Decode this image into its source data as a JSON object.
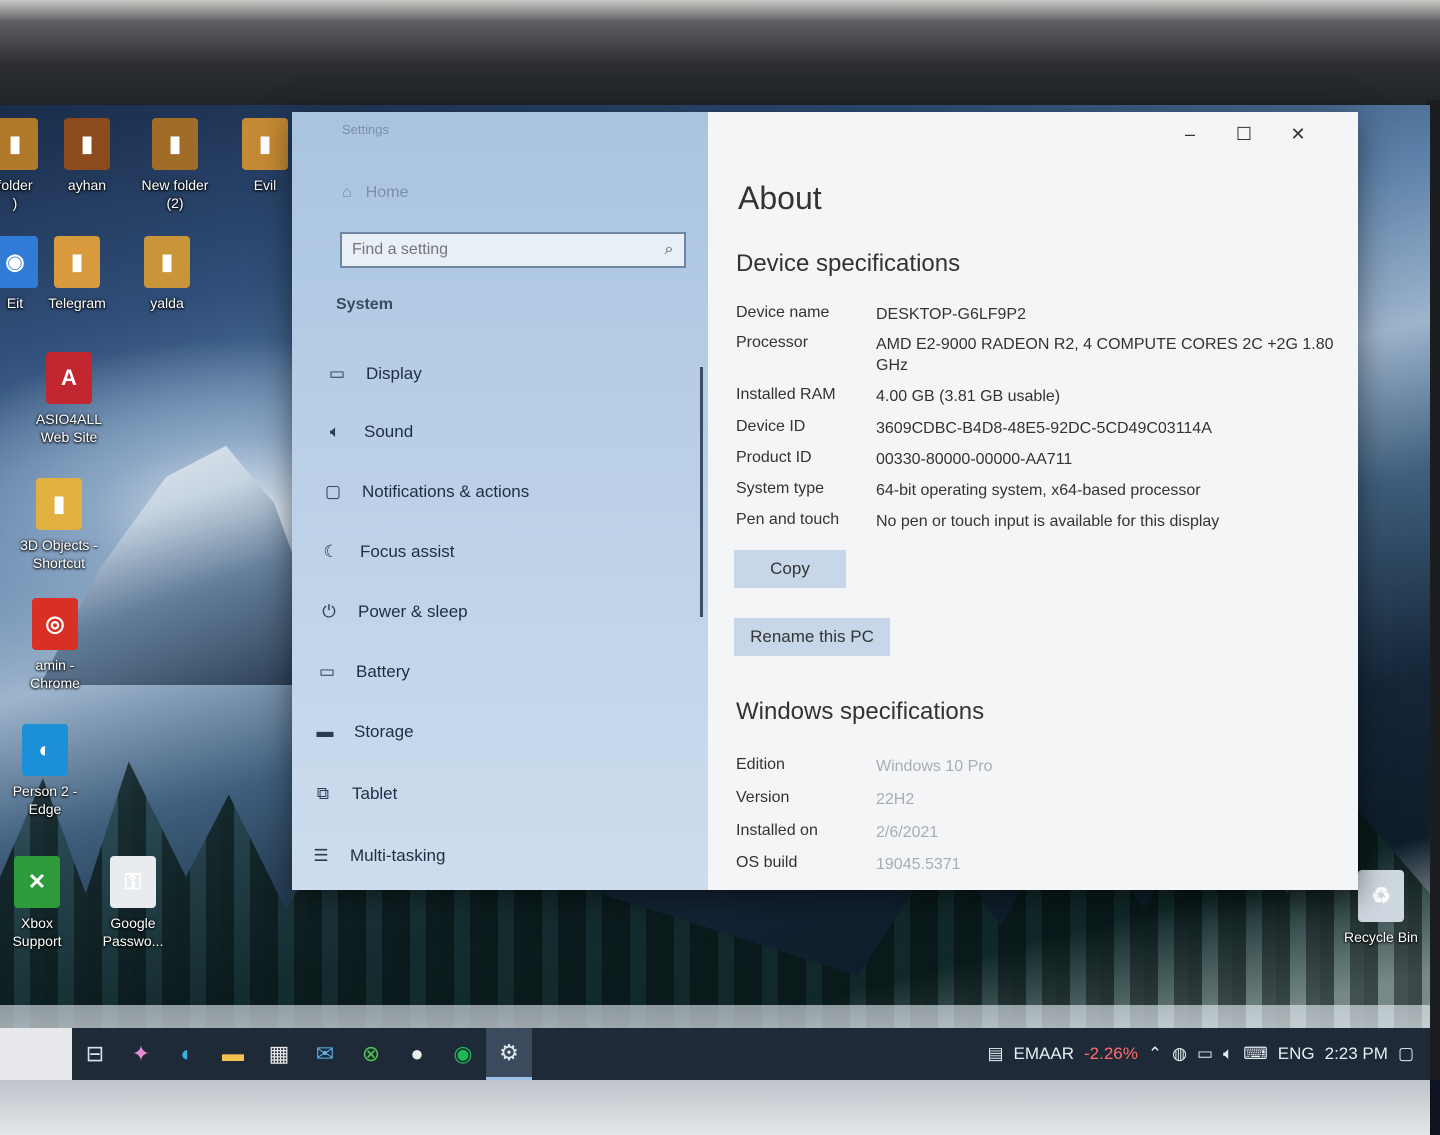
{
  "desktop_icons": [
    {
      "name": "folder",
      "label": "folder\n)",
      "color": "#b07a2a"
    },
    {
      "name": "ayhan",
      "label": "ayhan",
      "color": "#8c4b1c"
    },
    {
      "name": "new-folder-2",
      "label": "New folder\n(2)",
      "color": "#a16b28"
    },
    {
      "name": "evil",
      "label": "Evil",
      "color": "#c58a34"
    },
    {
      "name": "eit",
      "label": "Eit",
      "color": "#2f7bd6"
    },
    {
      "name": "telegram",
      "label": "Telegram",
      "color": "#d79a3c"
    },
    {
      "name": "yalda",
      "label": "yalda",
      "color": "#c8953a"
    },
    {
      "name": "asio4all",
      "label": "ASIO4ALL\nWeb Site",
      "color": "#c2262e"
    },
    {
      "name": "3d-objects",
      "label": "3D Objects -\nShortcut",
      "color": "#e0b040"
    },
    {
      "name": "amin-chrome",
      "label": "amin -\nChrome",
      "color": "#d93025"
    },
    {
      "name": "person2-edge",
      "label": "Person 2 -\nEdge",
      "color": "#1b8fd8"
    },
    {
      "name": "xbox",
      "label": "Xbox\nSupport",
      "color": "#2e9b3a"
    },
    {
      "name": "google-passwords",
      "label": "Google\nPasswo...",
      "color": "#e9ecef"
    },
    {
      "name": "recycle-bin",
      "label": "Recycle Bin",
      "color": "#cfd8e0"
    }
  ],
  "settings": {
    "window_title": "Settings",
    "home_label": "Home",
    "search_placeholder": "Find a setting",
    "section": "System",
    "nav": [
      {
        "label": "Display",
        "icon": "display-icon"
      },
      {
        "label": "Sound",
        "icon": "sound-icon"
      },
      {
        "label": "Notifications & actions",
        "icon": "notifications-icon"
      },
      {
        "label": "Focus assist",
        "icon": "focus-assist-icon"
      },
      {
        "label": "Power & sleep",
        "icon": "power-icon"
      },
      {
        "label": "Battery",
        "icon": "battery-icon"
      },
      {
        "label": "Storage",
        "icon": "storage-icon"
      },
      {
        "label": "Tablet",
        "icon": "tablet-icon"
      },
      {
        "label": "Multi-tasking",
        "icon": "multitasking-icon"
      }
    ],
    "about": {
      "title": "About",
      "device_specs_title": "Device specifications",
      "device_specs": [
        {
          "key": "Device name",
          "value": "DESKTOP-G6LF9P2"
        },
        {
          "key": "Processor",
          "value": "AMD E2-9000 RADEON R2, 4 COMPUTE CORES 2C +2G     1.80 GHz"
        },
        {
          "key": "Installed RAM",
          "value": "4.00 GB (3.81 GB usable)"
        },
        {
          "key": "Device ID",
          "value": "3609CDBC-B4D8-48E5-92DC-5CD49C03114A"
        },
        {
          "key": "Product ID",
          "value": "00330-80000-00000-AA711"
        },
        {
          "key": "System type",
          "value": "64-bit operating system, x64-based processor"
        },
        {
          "key": "Pen and touch",
          "value": "No pen or touch input is available for this display"
        }
      ],
      "copy_label": "Copy",
      "rename_label": "Rename this PC",
      "windows_specs_title": "Windows specifications",
      "windows_specs": [
        {
          "key": "Edition",
          "value": "Windows 10 Pro"
        },
        {
          "key": "Version",
          "value": "22H2"
        },
        {
          "key": "Installed on",
          "value": "2/6/2021"
        },
        {
          "key": "OS build",
          "value": "19045.5371"
        }
      ]
    }
  },
  "taskbar": {
    "icons": [
      "task-view-icon",
      "copilot-icon",
      "edge-icon",
      "file-explorer-icon",
      "store-icon",
      "mail-icon",
      "xbox-icon",
      "media-icon",
      "spotify-icon",
      "settings-icon"
    ],
    "stock_name": "EMAAR",
    "stock_change": "-2.26%",
    "language": "ENG",
    "time": "2:23 PM"
  }
}
